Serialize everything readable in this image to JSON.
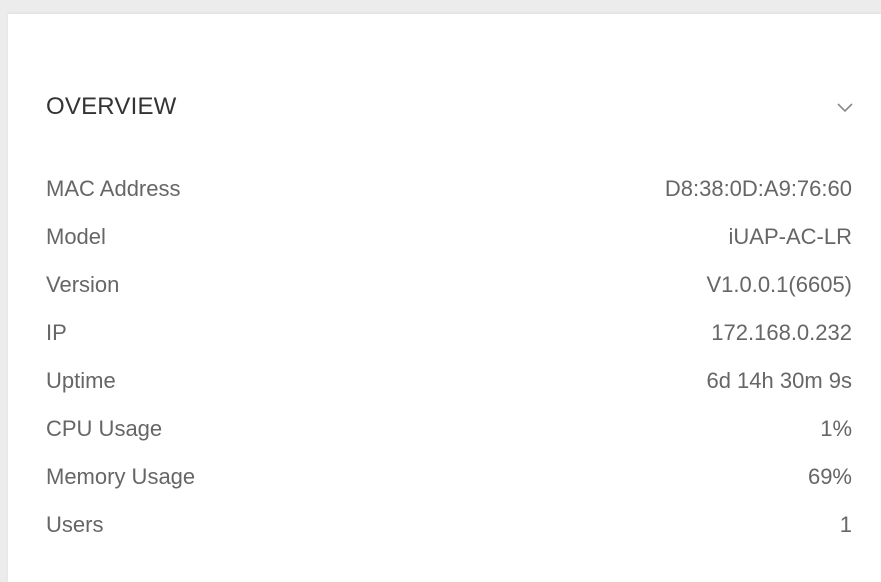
{
  "overview": {
    "title": "OVERVIEW",
    "collapse_icon": "chevron-down-icon",
    "rows": [
      {
        "label": "MAC Address",
        "value": "D8:38:0D:A9:76:60"
      },
      {
        "label": "Model",
        "value": "iUAP-AC-LR"
      },
      {
        "label": "Version",
        "value": "V1.0.0.1(6605)"
      },
      {
        "label": "IP",
        "value": "172.168.0.232"
      },
      {
        "label": "Uptime",
        "value": "6d 14h 30m 9s"
      },
      {
        "label": "CPU Usage",
        "value": "1%"
      },
      {
        "label": "Memory Usage",
        "value": "69%"
      },
      {
        "label": "Users",
        "value": "1"
      }
    ]
  }
}
